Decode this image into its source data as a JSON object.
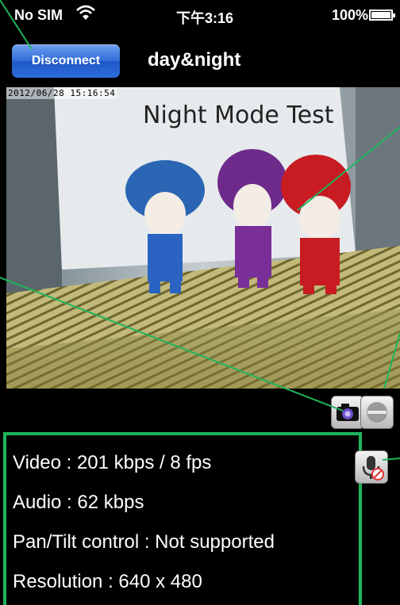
{
  "status_bar": {
    "carrier": "No SIM",
    "time": "下午3:16",
    "battery": "100%",
    "battery_level": 1.0
  },
  "nav": {
    "disconnect_label": "Disconnect",
    "title": "day&night"
  },
  "video": {
    "timestamp": "2012/06/28 15:16:54",
    "sign_text": "Night Mode Test"
  },
  "controls": {
    "snapshot_icon": "camera-icon",
    "night_mode_icon": "toggle-circle-icon",
    "audio_icon": "microphone-muted-icon"
  },
  "info": {
    "video": "Video : 201 kbps / 8 fps",
    "audio": "Audio : 62 kbps",
    "pan_tilt": "Pan/Tilt control : Not supported",
    "resolution": "Resolution : 640 x 480"
  },
  "colors": {
    "annotation": "#1eb55c",
    "button_blue": "#2f6bd8"
  }
}
